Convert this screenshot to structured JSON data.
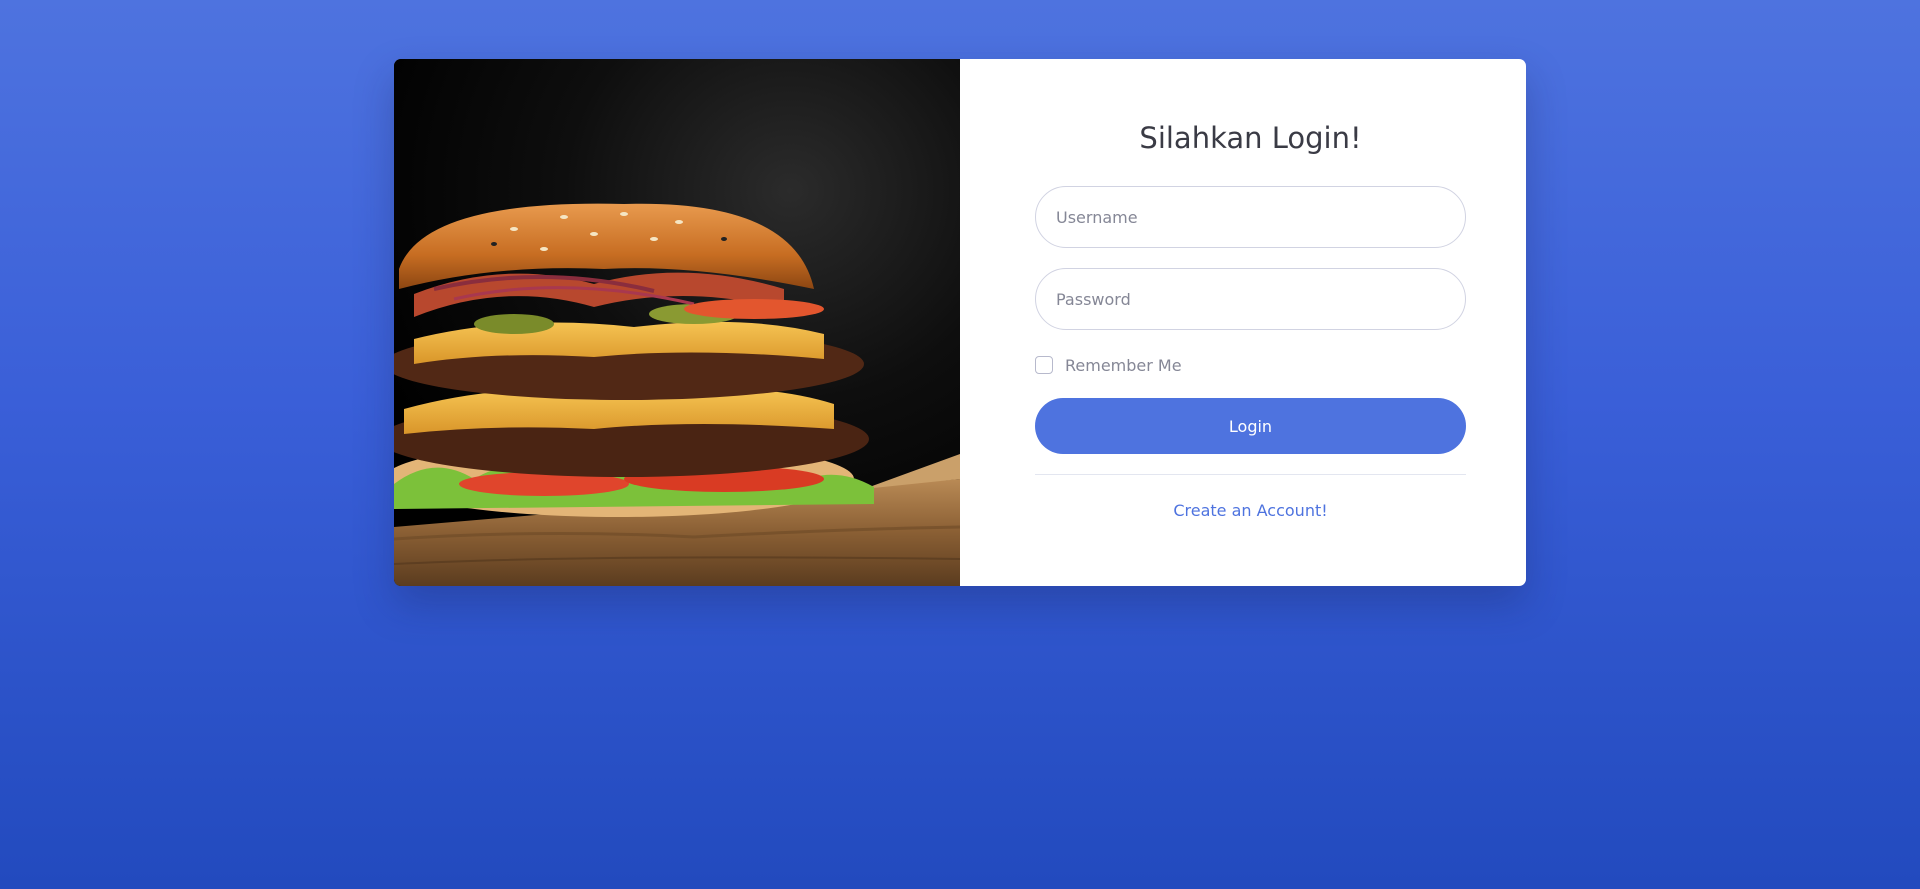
{
  "login": {
    "title": "Silahkan Login!",
    "username_placeholder": "Username",
    "password_placeholder": "Password",
    "remember_label": "Remember Me",
    "remember_checked": false,
    "submit_label": "Login",
    "create_account_label": "Create an Account!"
  },
  "theme": {
    "accent": "#4e73df",
    "background_top": "#4e73df",
    "background_bottom": "#224abe"
  },
  "image": {
    "subject": "burger-photo"
  }
}
